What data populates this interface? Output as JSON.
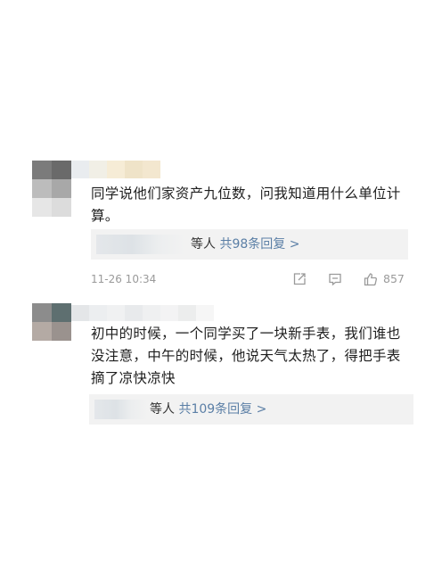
{
  "comments": [
    {
      "text": "同学说他们家资产九位数，问我知道用什么单位计算。",
      "replies": {
        "prefix": "等人",
        "count_label": "共98条回复 >"
      },
      "time": "11-26 10:34",
      "likes": "857",
      "icons": [
        "share-icon",
        "comment-icon",
        "thumbs-up-icon"
      ]
    },
    {
      "text": "初中的时候，一个同学买了一块新手表，我们谁也没注意，中午的时候，他说天气太热了，得把手表摘了凉快凉快",
      "replies": {
        "prefix": "等人",
        "count_label": "共109条回复 >"
      }
    }
  ],
  "colors": {
    "reply_link": "#5b7fa6",
    "meta_gray": "#9a9a9a",
    "reply_bg": "#f2f2f2"
  }
}
